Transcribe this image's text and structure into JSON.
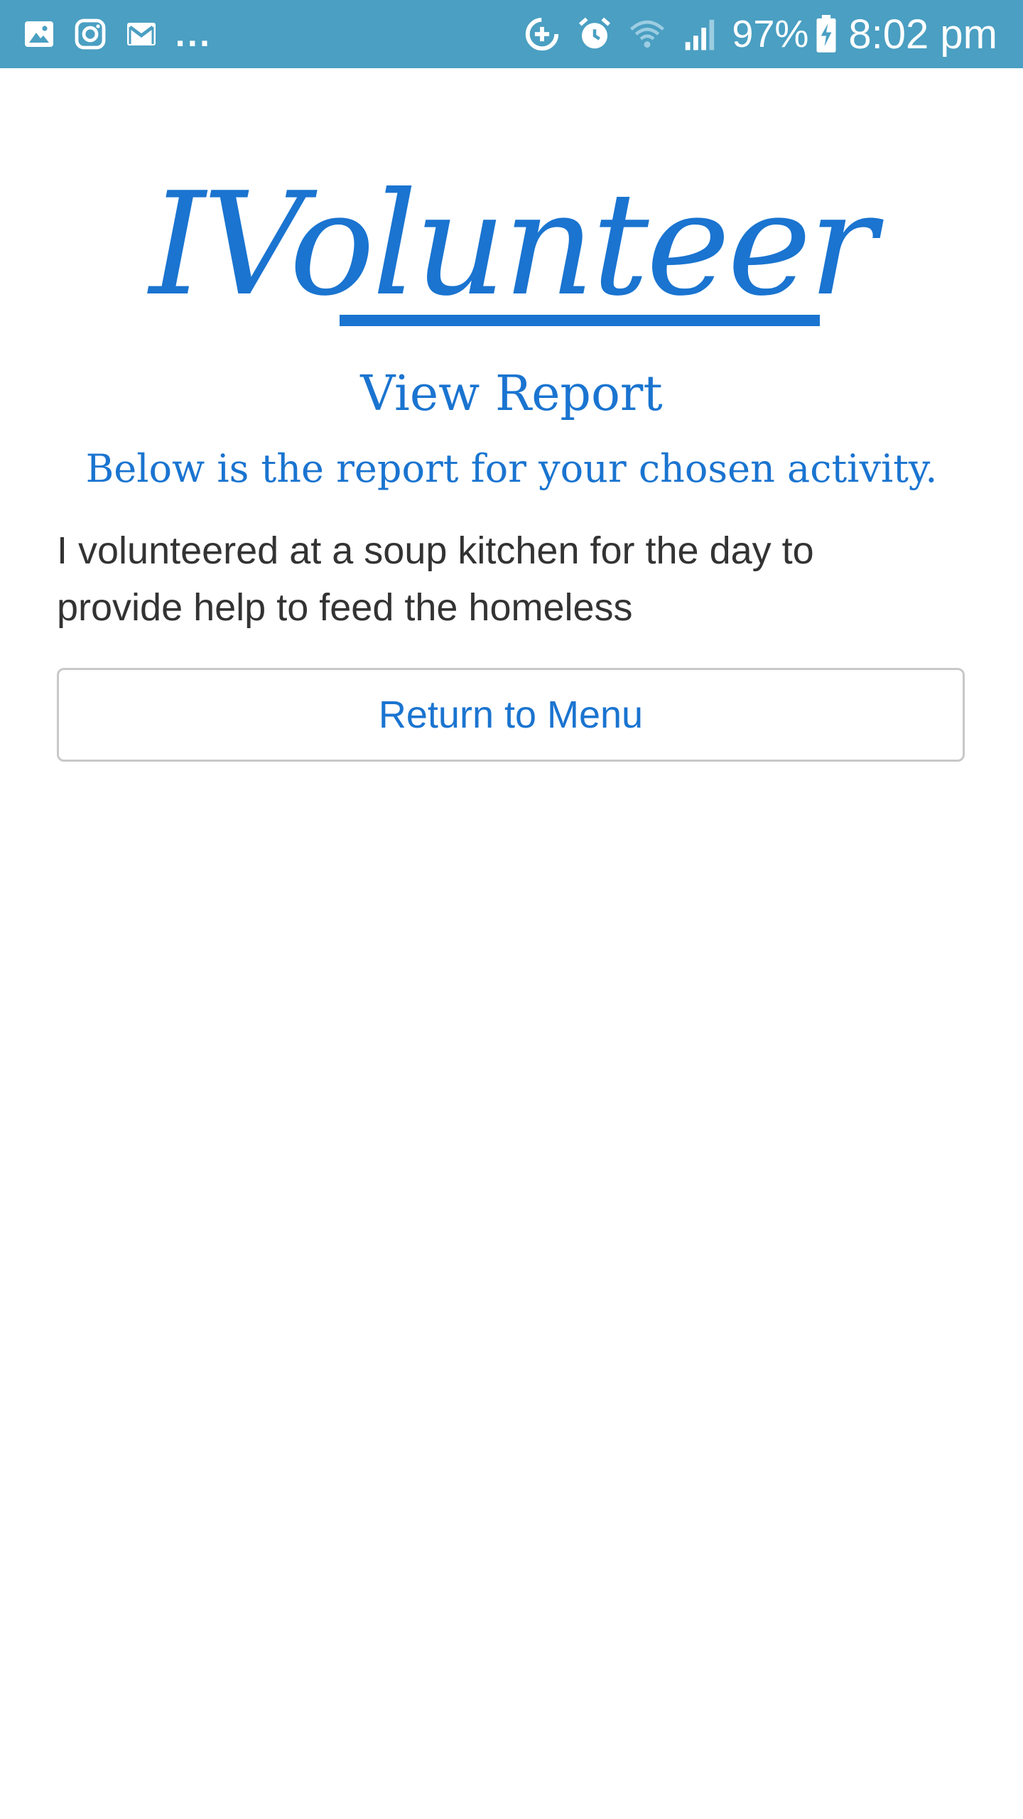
{
  "status_bar": {
    "left_icons": [
      "gallery-icon",
      "instagram-icon",
      "gmail-icon"
    ],
    "overflow": "...",
    "right_icons": [
      "data-saver-icon",
      "alarm-icon",
      "wifi-icon",
      "signal-icon"
    ],
    "battery_percent": "97%",
    "time": "8:02 pm",
    "background_color": "#4a9fc2"
  },
  "app": {
    "logo_text": "IVolunteer",
    "accent_color": "#1a74d0"
  },
  "page": {
    "title": "View Report",
    "subtitle": "Below is the report for your chosen activity.",
    "report_text": "I volunteered at a soup kitchen for the day to provide help to feed the homeless",
    "return_button_label": "Return to Menu"
  }
}
